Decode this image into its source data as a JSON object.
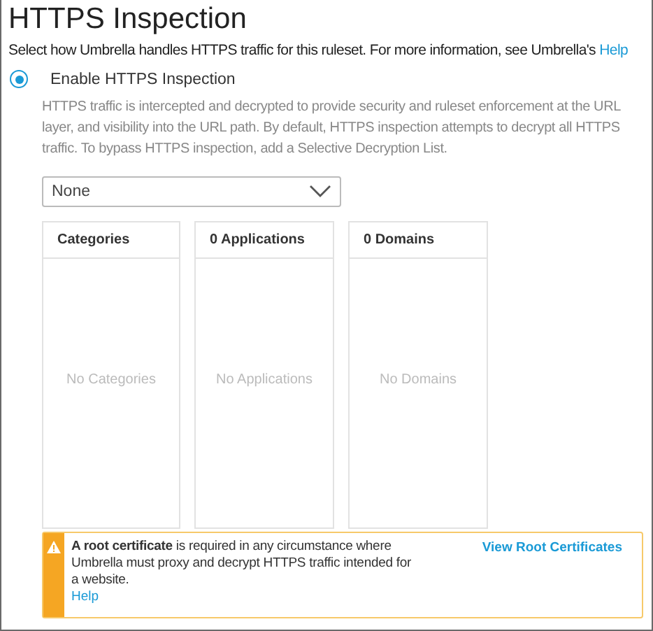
{
  "title": "HTTPS Inspection",
  "intro": {
    "text": "Select how Umbrella handles HTTPS traffic for this ruleset. For more information, see Umbrella's",
    "link": "Help"
  },
  "option": {
    "label": "Enable HTTPS Inspection",
    "selected": true,
    "description": "HTTPS traffic is intercepted and decrypted to provide security and ruleset enforcement at the URL layer, and visibility into the URL path. By default, HTTPS inspection attempts to decrypt all HTTPS traffic. To bypass HTTPS inspection, add a Selective Decryption List."
  },
  "dropdown": {
    "value": "None"
  },
  "panels": [
    {
      "heading": "Categories",
      "empty": "No Categories"
    },
    {
      "heading": "0 Applications",
      "empty": "No Applications"
    },
    {
      "heading": "0 Domains",
      "empty": "No Domains"
    }
  ],
  "alert": {
    "message": "**A root certificate** is required in any circumstance where Umbrella must proxy and decrypt HTTPS traffic intended for a website.",
    "help": "Help",
    "action": "View Root Certificates"
  }
}
